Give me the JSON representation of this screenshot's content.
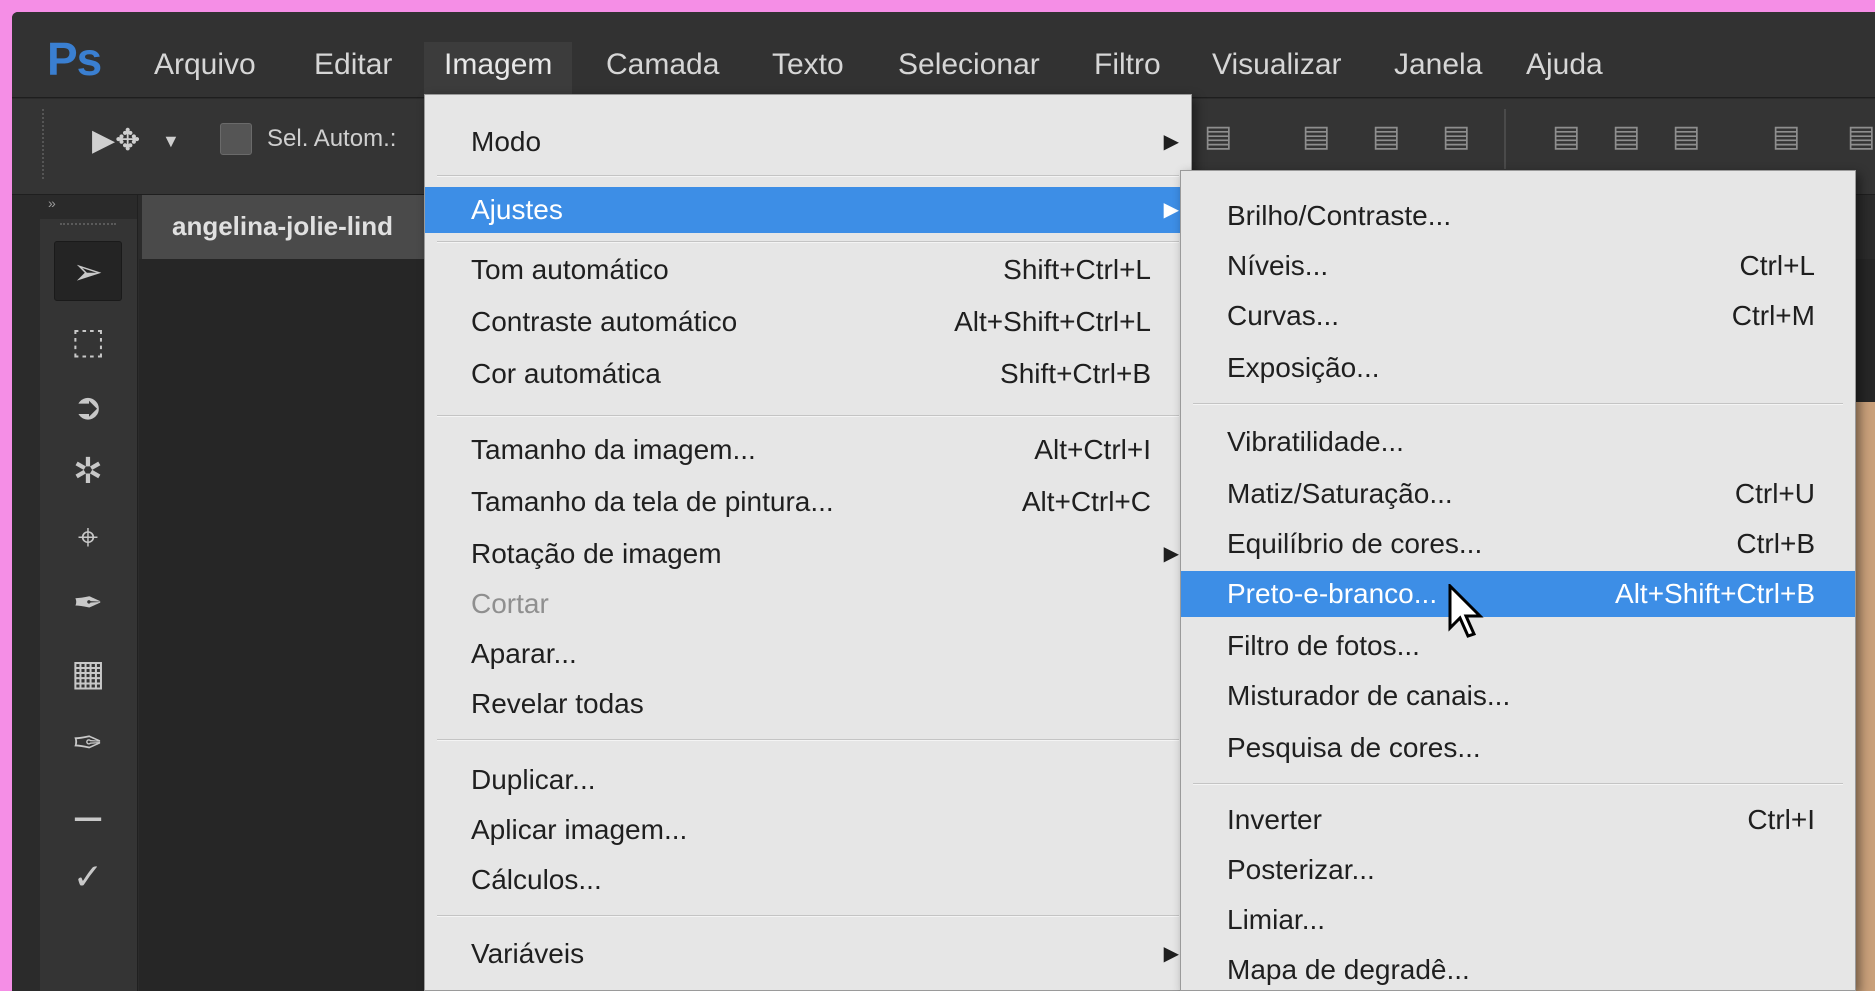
{
  "app": {
    "logo": "Ps"
  },
  "menubar": {
    "items": [
      "Arquivo",
      "Editar",
      "Imagem",
      "Camada",
      "Texto",
      "Selecionar",
      "Filtro",
      "Visualizar",
      "Janela",
      "Ajuda"
    ],
    "active": "Imagem"
  },
  "options": {
    "auto_select_label": "Sel. Autom.:"
  },
  "document": {
    "tab_title": "angelina-jolie-lind"
  },
  "image_menu": {
    "items": [
      {
        "label": "Modo",
        "shortcut": "",
        "submenu": true
      },
      {
        "label": "Ajustes",
        "shortcut": "",
        "submenu": true,
        "highlighted": true
      },
      {
        "label": "Tom automático",
        "shortcut": "Shift+Ctrl+L"
      },
      {
        "label": "Contraste automático",
        "shortcut": "Alt+Shift+Ctrl+L"
      },
      {
        "label": "Cor automática",
        "shortcut": "Shift+Ctrl+B"
      },
      {
        "label": "Tamanho da imagem...",
        "shortcut": "Alt+Ctrl+I"
      },
      {
        "label": "Tamanho da tela de pintura...",
        "shortcut": "Alt+Ctrl+C"
      },
      {
        "label": "Rotação de imagem",
        "shortcut": "",
        "submenu": true
      },
      {
        "label": "Cortar",
        "shortcut": "",
        "disabled": true
      },
      {
        "label": "Aparar...",
        "shortcut": ""
      },
      {
        "label": "Revelar todas",
        "shortcut": ""
      },
      {
        "label": "Duplicar...",
        "shortcut": ""
      },
      {
        "label": "Aplicar imagem...",
        "shortcut": ""
      },
      {
        "label": "Cálculos...",
        "shortcut": ""
      },
      {
        "label": "Variáveis",
        "shortcut": "",
        "submenu": true
      }
    ]
  },
  "adjust_menu": {
    "items": [
      {
        "label": "Brilho/Contraste...",
        "shortcut": ""
      },
      {
        "label": "Níveis...",
        "shortcut": "Ctrl+L"
      },
      {
        "label": "Curvas...",
        "shortcut": "Ctrl+M"
      },
      {
        "label": "Exposição...",
        "shortcut": ""
      },
      {
        "label": "Vibratilidade...",
        "shortcut": ""
      },
      {
        "label": "Matiz/Saturação...",
        "shortcut": "Ctrl+U"
      },
      {
        "label": "Equilíbrio de cores...",
        "shortcut": "Ctrl+B"
      },
      {
        "label": "Preto-e-branco...",
        "shortcut": "Alt+Shift+Ctrl+B",
        "highlighted": true
      },
      {
        "label": "Filtro de fotos...",
        "shortcut": ""
      },
      {
        "label": "Misturador de canais...",
        "shortcut": ""
      },
      {
        "label": "Pesquisa de cores...",
        "shortcut": ""
      },
      {
        "label": "Inverter",
        "shortcut": "Ctrl+I"
      },
      {
        "label": "Posterizar...",
        "shortcut": ""
      },
      {
        "label": "Limiar...",
        "shortcut": ""
      },
      {
        "label": "Mapa de degradê...",
        "shortcut": ""
      }
    ]
  },
  "colors": {
    "highlight": "#3d8ee6",
    "frame": "#f58ee6",
    "ps_blue": "#3a7fd1"
  }
}
